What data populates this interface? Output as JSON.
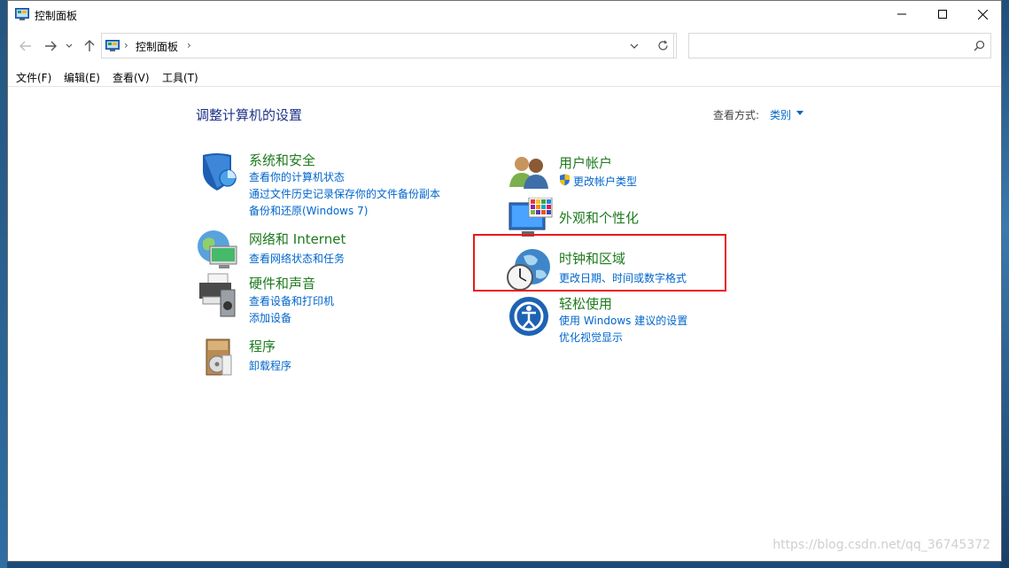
{
  "window": {
    "title": "控制面板"
  },
  "address": {
    "crumb": "控制面板",
    "separator": "›",
    "search_placeholder": ""
  },
  "menu": [
    "文件(F)",
    "编辑(E)",
    "查看(V)",
    "工具(T)"
  ],
  "content": {
    "heading": "调整计算机的设置",
    "view_by_label": "查看方式:",
    "view_by_value": "类别"
  },
  "categories_left": [
    {
      "title": "系统和安全",
      "icon": "shield-icon",
      "links": [
        "查看你的计算机状态",
        "通过文件历史记录保存你的文件备份副本",
        "备份和还原(Windows 7)"
      ]
    },
    {
      "title": "网络和 Internet",
      "icon": "network-icon",
      "links": [
        "查看网络状态和任务"
      ]
    },
    {
      "title": "硬件和声音",
      "icon": "printer-speaker-icon",
      "links": [
        "查看设备和打印机",
        "添加设备"
      ]
    },
    {
      "title": "程序",
      "icon": "programs-icon",
      "links": [
        "卸载程序"
      ]
    }
  ],
  "categories_right": [
    {
      "title": "用户帐户",
      "icon": "users-icon",
      "links": [
        "更改帐户类型"
      ]
    },
    {
      "title": "外观和个性化",
      "icon": "appearance-icon",
      "links": []
    },
    {
      "title": "时钟和区域",
      "icon": "clock-globe-icon",
      "links": [
        "更改日期、时间或数字格式"
      ]
    },
    {
      "title": "轻松使用",
      "icon": "ease-of-access-icon",
      "links": [
        "使用 Windows 建议的设置",
        "优化视觉显示"
      ]
    }
  ],
  "watermark": "https://blog.csdn.net/qq_36745372",
  "colors": {
    "title_blue": "#1e3287",
    "category_green": "#1e7a1e",
    "link_blue": "#0066cc",
    "highlight_red": "#e81919"
  }
}
